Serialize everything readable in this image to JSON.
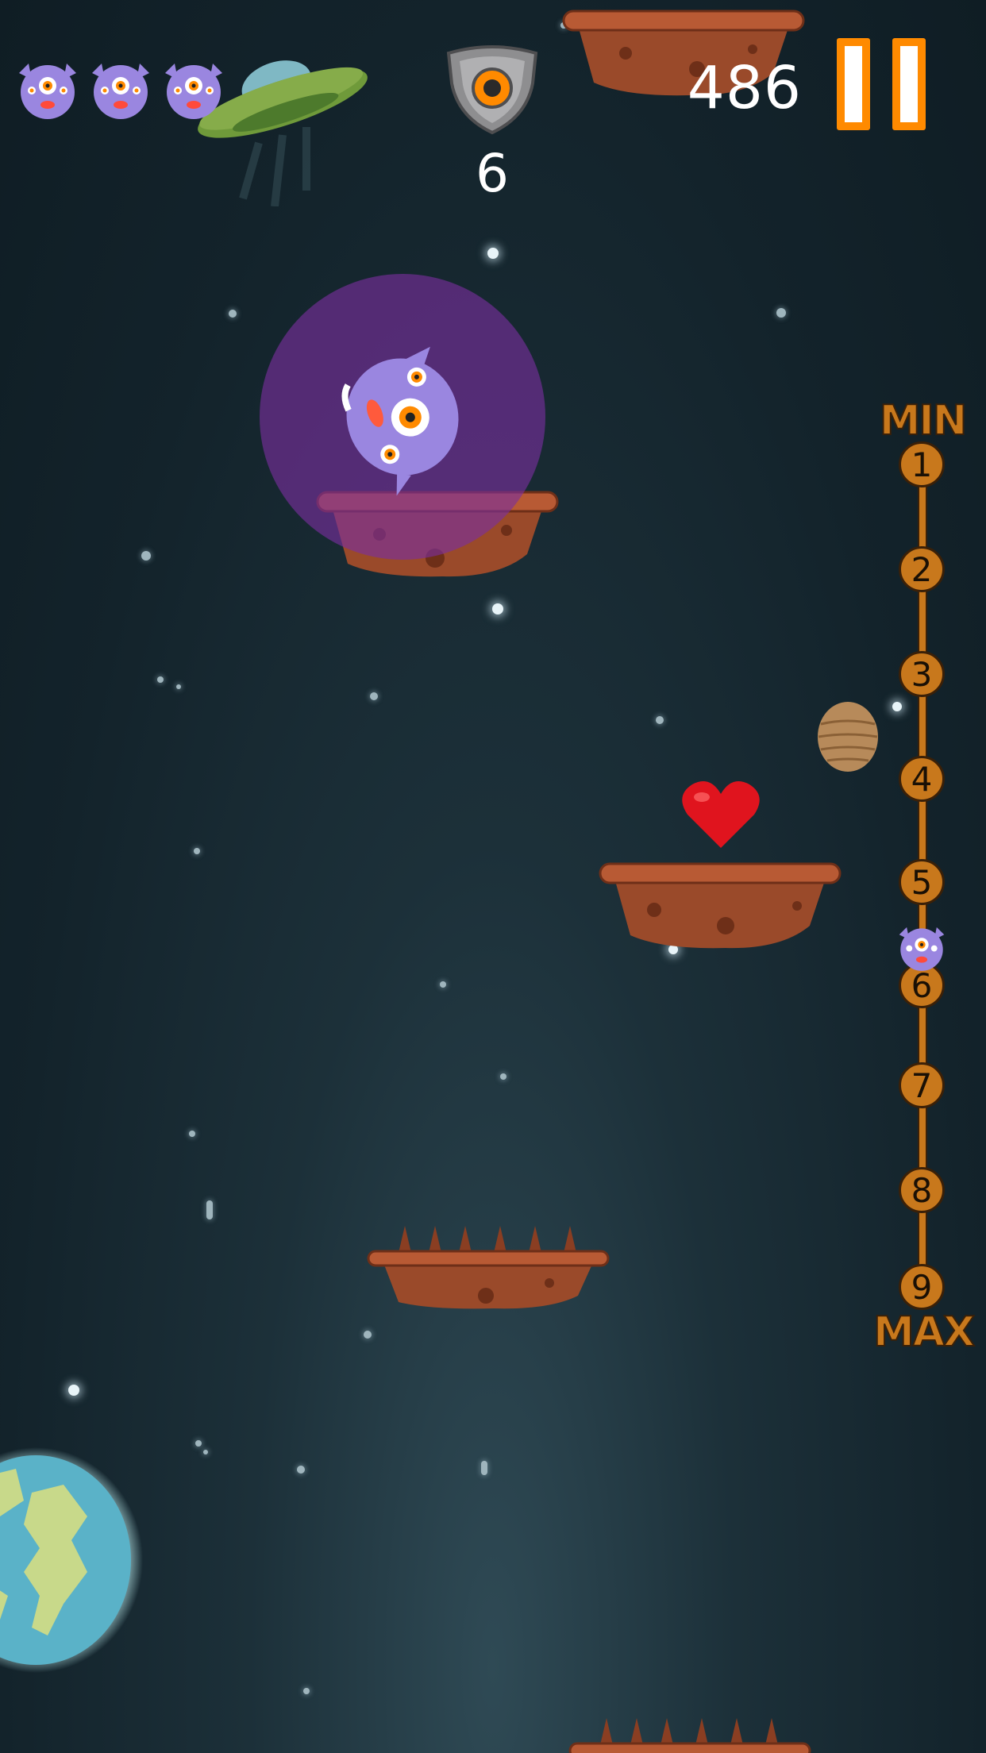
{
  "hud": {
    "lives_count": 3,
    "life_icon": "purple-monster-face-icon",
    "shield_icon": "shield-icon",
    "shield_count": "6",
    "score": "486",
    "pause_icon": "pause-icon"
  },
  "height_meter": {
    "top_label": "MIN",
    "bottom_label": "MAX",
    "levels": [
      "1",
      "2",
      "3",
      "4",
      "5",
      "6",
      "7",
      "8",
      "9"
    ],
    "current_level": 6
  },
  "colors": {
    "accent_orange": "#ff8a00",
    "meter_brown": "#c8781c",
    "shield_bubble": "#7a2fa0",
    "monster_purple": "#9a86e0",
    "heart_red": "#e0141e",
    "rock_brown": "#9a4a2a"
  }
}
